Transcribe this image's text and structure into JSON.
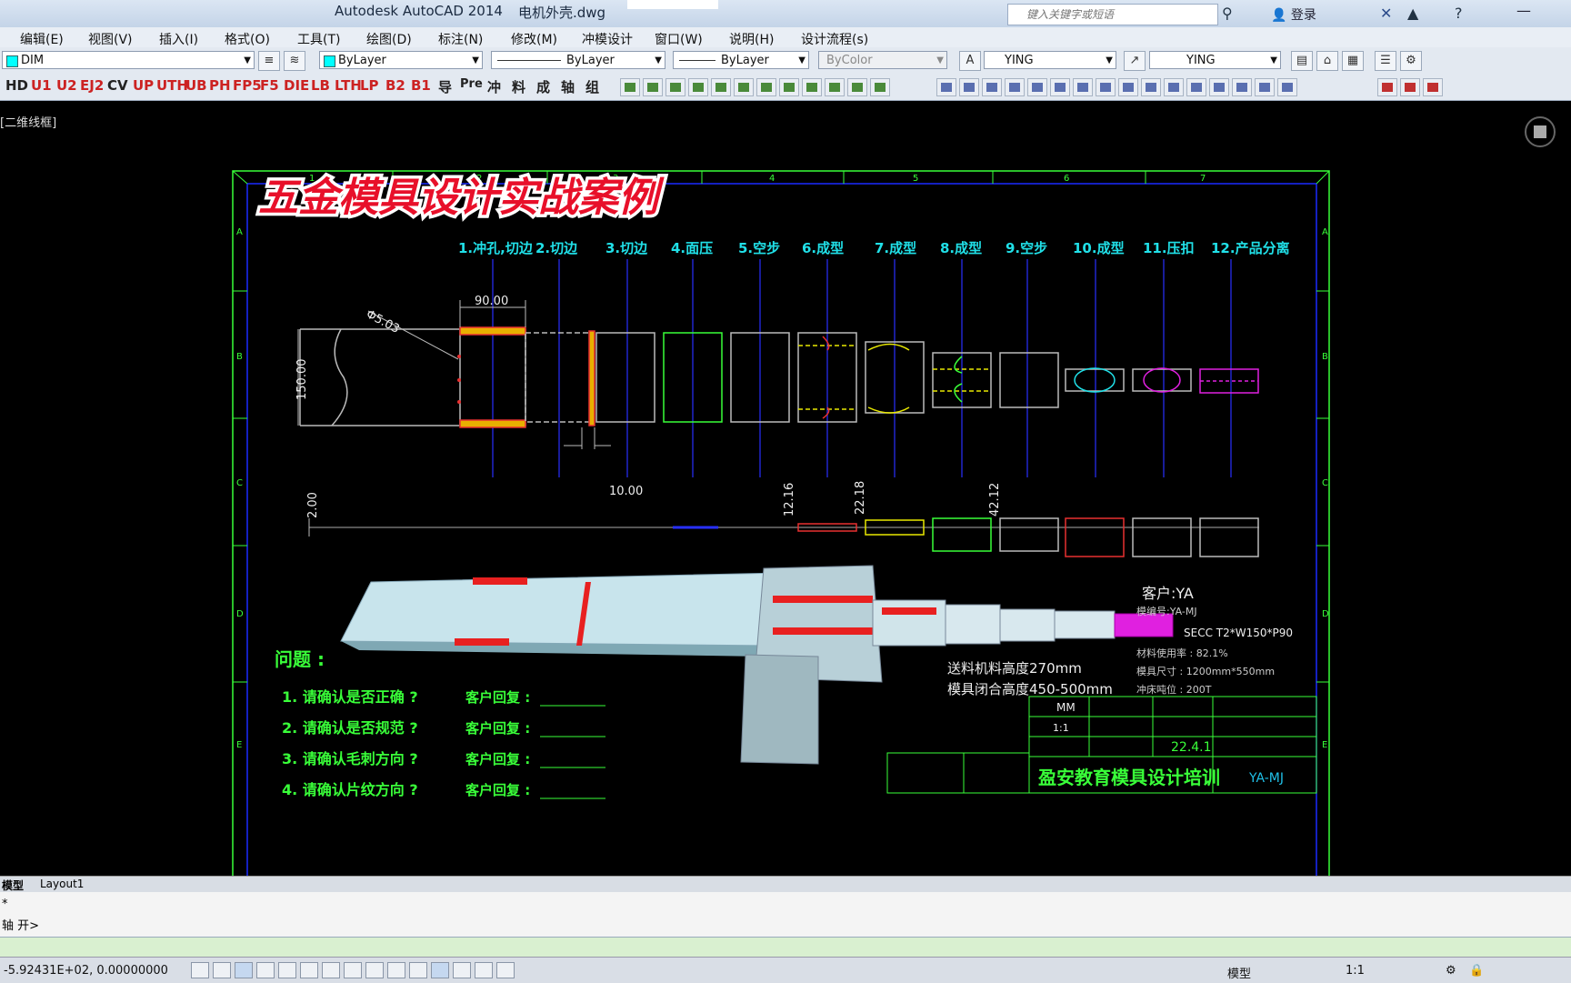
{
  "title": {
    "app": "Autodesk AutoCAD 2014",
    "file": "电机外壳.dwg",
    "search_placeholder": "键入关键字或短语",
    "login": "登录"
  },
  "menu": [
    "编辑(E)",
    "视图(V)",
    "插入(I)",
    "格式(O)",
    "工具(T)",
    "绘图(D)",
    "标注(N)",
    "修改(M)",
    "冲模设计",
    "窗口(W)",
    "说明(H)",
    "设计流程(s)"
  ],
  "props": {
    "layer": "DIM",
    "color": "ByLayer",
    "linetype": "ByLayer",
    "lineweight": "ByLayer",
    "plotstyle": "ByColor",
    "textstyle": "YING",
    "dimstyle": "YING"
  },
  "custom_tools": [
    "HD",
    "U1",
    "U2",
    "EJ2",
    "CV",
    "UP",
    "UTH",
    "UB",
    "PH",
    "FP5",
    "F5",
    "DIE",
    "LB",
    "LTH",
    "LP",
    "B2",
    "B1",
    "导",
    "Pre",
    "冲",
    "料",
    "成",
    "轴",
    "组"
  ],
  "view_label": "[二维线框]",
  "drawing": {
    "banner": "五金模具设计实战案例",
    "steps": [
      "1.冲孔,切边",
      "2.切边",
      "3.切边",
      "4.面压",
      "5.空步",
      "6.成型",
      "7.成型",
      "8.成型",
      "9.空步",
      "10.成型",
      "11.压扣",
      "12.产品分离"
    ],
    "col_marks": [
      "1",
      "2",
      "3",
      "4",
      "5",
      "6",
      "7"
    ],
    "row_marks": [
      "A",
      "B",
      "C",
      "D",
      "E"
    ],
    "dims": {
      "d1": "90.00",
      "d2": "Φ5.03",
      "d3": "150.00",
      "d4": "10.00",
      "d5": "2.00",
      "d6": "12.16",
      "d7": "22.18",
      "d8": "42.12"
    },
    "client": [
      "客户:YA",
      "模编号:YA-MJ",
      "SECC T2*W150*P90",
      "材料使用率 : 82.1%",
      "模具尺寸 : 1200mm*550mm",
      "冲床吨位 : 200T"
    ],
    "heights": [
      "送料机料高度270mm",
      "模具闭合高度450-500mm"
    ],
    "questions_title": "问题 :",
    "questions": [
      "1. 请确认是否正确 ?",
      "2. 请确认是否规范 ?",
      "3. 请确认毛刺方向 ?",
      "4. 请确认片纹方向 ?"
    ],
    "reply_label": "客户回复 :",
    "titleblock": {
      "company": "盈安教育模具设计培训",
      "code": "YA-MJ",
      "unit": "MM",
      "scale": "1:1",
      "date": "22.4.1"
    }
  },
  "tabs": [
    "模型",
    "Layout1"
  ],
  "command": [
    "*",
    "轴 开>",
    ""
  ],
  "status": {
    "coord": "-5.92431E+02, 0.00000000",
    "model": "模型",
    "scale": "1:1"
  }
}
